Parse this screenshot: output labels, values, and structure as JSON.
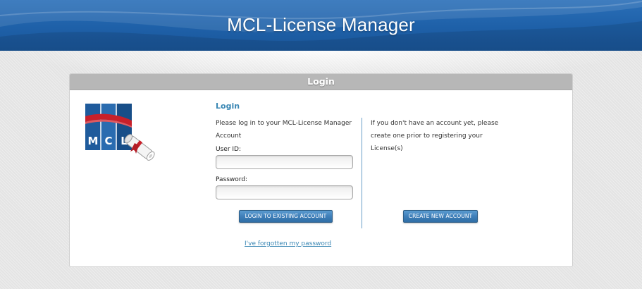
{
  "header": {
    "title": "MCL-License Manager"
  },
  "panel": {
    "title": "Login"
  },
  "logo": {
    "letters": [
      "M",
      "C",
      "L"
    ]
  },
  "login": {
    "section_title": "Login",
    "intro": "Please log in to your MCL-License Manager Account",
    "user_id_label": "User ID:",
    "user_id_value": "",
    "password_label": "Password:",
    "password_value": "",
    "login_button": "LOGIN TO EXISTING ACCOUNT",
    "forgot_link": "I've forgotten my password"
  },
  "register": {
    "text": "If you don't have an account yet, please create one prior to registering your License(s)",
    "create_button": "CREATE NEW ACCOUNT"
  },
  "colors": {
    "header_blue": "#1e60a8",
    "accent": "#3a87b4",
    "button": "#3f7fb9",
    "panel_header": "#b7b7b7"
  }
}
